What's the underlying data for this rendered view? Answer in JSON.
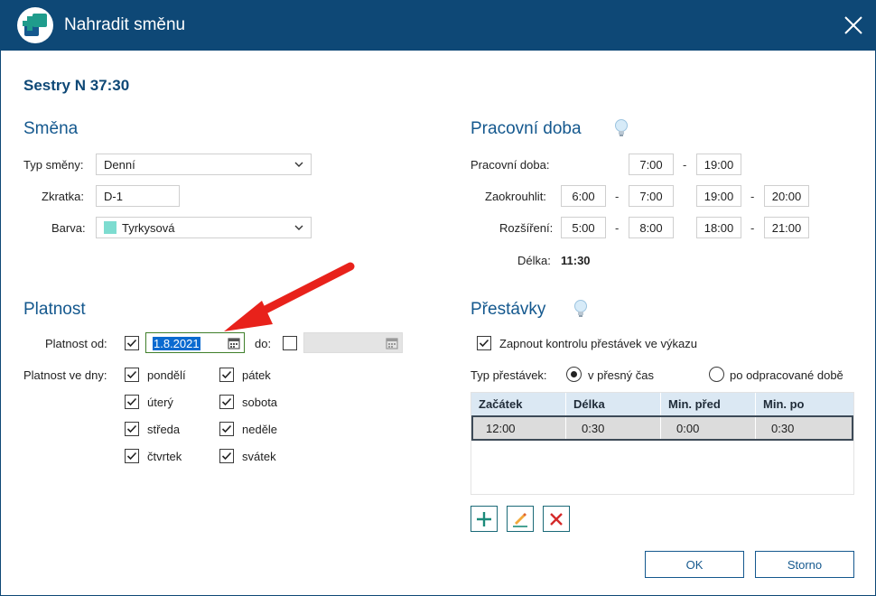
{
  "window": {
    "title": "Nahradit směnu",
    "close_icon": "close-icon",
    "logo_icon": "app-logo-plus-icon"
  },
  "shift_name": "Sestry N 37:30",
  "smena": {
    "title": "Směna",
    "type_label": "Typ směny:",
    "type_value": "Denní",
    "abbr_label": "Zkratka:",
    "abbr_value": "D-1",
    "color_label": "Barva:",
    "color_value": "Tyrkysová",
    "color_hex": "#7ddcd0"
  },
  "pracovni_doba": {
    "title": "Pracovní doba",
    "work_label": "Pracovní doba:",
    "work_from": "7:00",
    "work_to": "19:00",
    "round_label": "Zaokrouhlit:",
    "round": [
      "6:00",
      "7:00",
      "19:00",
      "20:00"
    ],
    "extend_label": "Rozšíření:",
    "extend": [
      "5:00",
      "8:00",
      "18:00",
      "21:00"
    ],
    "length_label": "Délka:",
    "length_value": "11:30",
    "dash": "-"
  },
  "platnost": {
    "title": "Platnost",
    "from_label": "Platnost od:",
    "from_value": "1.8.2021",
    "to_label": "do:",
    "days_label": "Platnost ve dny:",
    "days_left": [
      "pondělí",
      "úterý",
      "středa",
      "čtvrtek"
    ],
    "days_right": [
      "pátek",
      "sobota",
      "neděle",
      "svátek"
    ]
  },
  "prestavky": {
    "title": "Přestávky",
    "control_label": "Zapnout kontrolu přestávek ve výkazu",
    "type_label": "Typ přestávek:",
    "option_exact": "v přesný čas",
    "option_after": "po odpracované době",
    "columns": [
      "Začátek",
      "Délka",
      "Min. před",
      "Min. po"
    ],
    "rows": [
      [
        "12:00",
        "0:30",
        "0:00",
        "0:30"
      ]
    ]
  },
  "buttons": {
    "ok": "OK",
    "cancel": "Storno"
  },
  "colors": {
    "titlebar": "#0e4876",
    "accent": "#14588e",
    "add": "#1b8a7a",
    "delete": "#d42a2a",
    "arrow": "#e8221b"
  }
}
